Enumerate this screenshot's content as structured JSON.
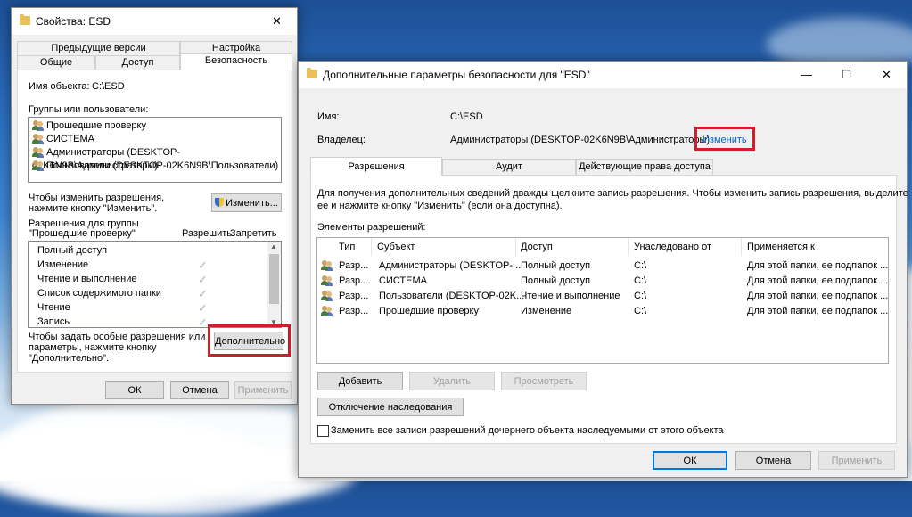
{
  "left_window": {
    "title": "Свойства: ESD",
    "close_glyph": "✕",
    "tabs_row1": [
      "Предыдущие версии",
      "Настройка"
    ],
    "tabs_row2": [
      "Общие",
      "Доступ",
      "Безопасность"
    ],
    "object_label": "Имя объекта:",
    "object_value": "C:\\ESD",
    "groups_label": "Группы или пользователи:",
    "groups": [
      "Прошедшие проверку",
      "СИСТЕМА",
      "Администраторы (DESKTOP-02K6N9B\\Администраторы)",
      "Пользователи (DESKTOP-02K6N9B\\Пользователи)"
    ],
    "change_hint_1": "Чтобы изменить разрешения,",
    "change_hint_2": "нажмите кнопку \"Изменить\".",
    "change_button": "Изменить...",
    "perm_for_1": "Разрешения для группы",
    "perm_for_2": "\"Прошедшие проверку\"",
    "allow_col": "Разрешить",
    "deny_col": "Запретить",
    "permissions": [
      "Полный доступ",
      "Изменение",
      "Чтение и выполнение",
      "Список содержимого папки",
      "Чтение",
      "Запись"
    ],
    "special_hint_1": "Чтобы задать особые разрешения или",
    "special_hint_2": "параметры, нажмите кнопку",
    "special_hint_3": "\"Дополнительно\".",
    "advanced_button": "Дополнительно",
    "ok": "ОК",
    "cancel": "Отмена",
    "apply": "Применить"
  },
  "right_window": {
    "title": "Дополнительные параметры безопасности  для \"ESD\"",
    "min_glyph": "—",
    "max_glyph": "☐",
    "close_glyph": "✕",
    "name_label": "Имя:",
    "name_value": "C:\\ESD",
    "owner_label": "Владелец:",
    "owner_value": "Администраторы (DESKTOP-02K6N9B\\Администраторы)",
    "owner_change_link": "Изменить",
    "tabs": [
      "Разрешения",
      "Аудит",
      "Действующие права доступа"
    ],
    "info_1": "Для получения дополнительных сведений дважды щелкните запись разрешения. Чтобы изменить запись разрешения, выделите",
    "info_2": "ее и нажмите кнопку \"Изменить\" (если она доступна).",
    "entries_label": "Элементы разрешений:",
    "columns": [
      "Тип",
      "Субъект",
      "Доступ",
      "Унаследовано от",
      "Применяется к"
    ],
    "rows": [
      {
        "type": "Разр...",
        "subject": "Администраторы (DESKTOP-...",
        "access": "Полный доступ",
        "inherited": "C:\\",
        "applies": "Для этой папки, ее подпапок ..."
      },
      {
        "type": "Разр...",
        "subject": "СИСТЕМА",
        "access": "Полный доступ",
        "inherited": "C:\\",
        "applies": "Для этой папки, ее подпапок ..."
      },
      {
        "type": "Разр...",
        "subject": "Пользователи (DESKTOP-02K...",
        "access": "Чтение и выполнение",
        "inherited": "C:\\",
        "applies": "Для этой папки, ее подпапок ..."
      },
      {
        "type": "Разр...",
        "subject": "Прошедшие проверку",
        "access": "Изменение",
        "inherited": "C:\\",
        "applies": "Для этой папки, ее подпапок ..."
      }
    ],
    "add_button": "Добавить",
    "remove_button": "Удалить",
    "view_button": "Просмотреть",
    "disable_inheritance_button": "Отключение наследования",
    "replace_checkbox_label": "Заменить все записи разрешений дочернего объекта наследуемыми от этого объекта",
    "ok": "ОК",
    "cancel": "Отмена",
    "apply": "Применить"
  },
  "colors": {
    "highlight_red": "#d01e2a",
    "link_blue": "#0066cc",
    "button_focus": "#0078d7"
  }
}
